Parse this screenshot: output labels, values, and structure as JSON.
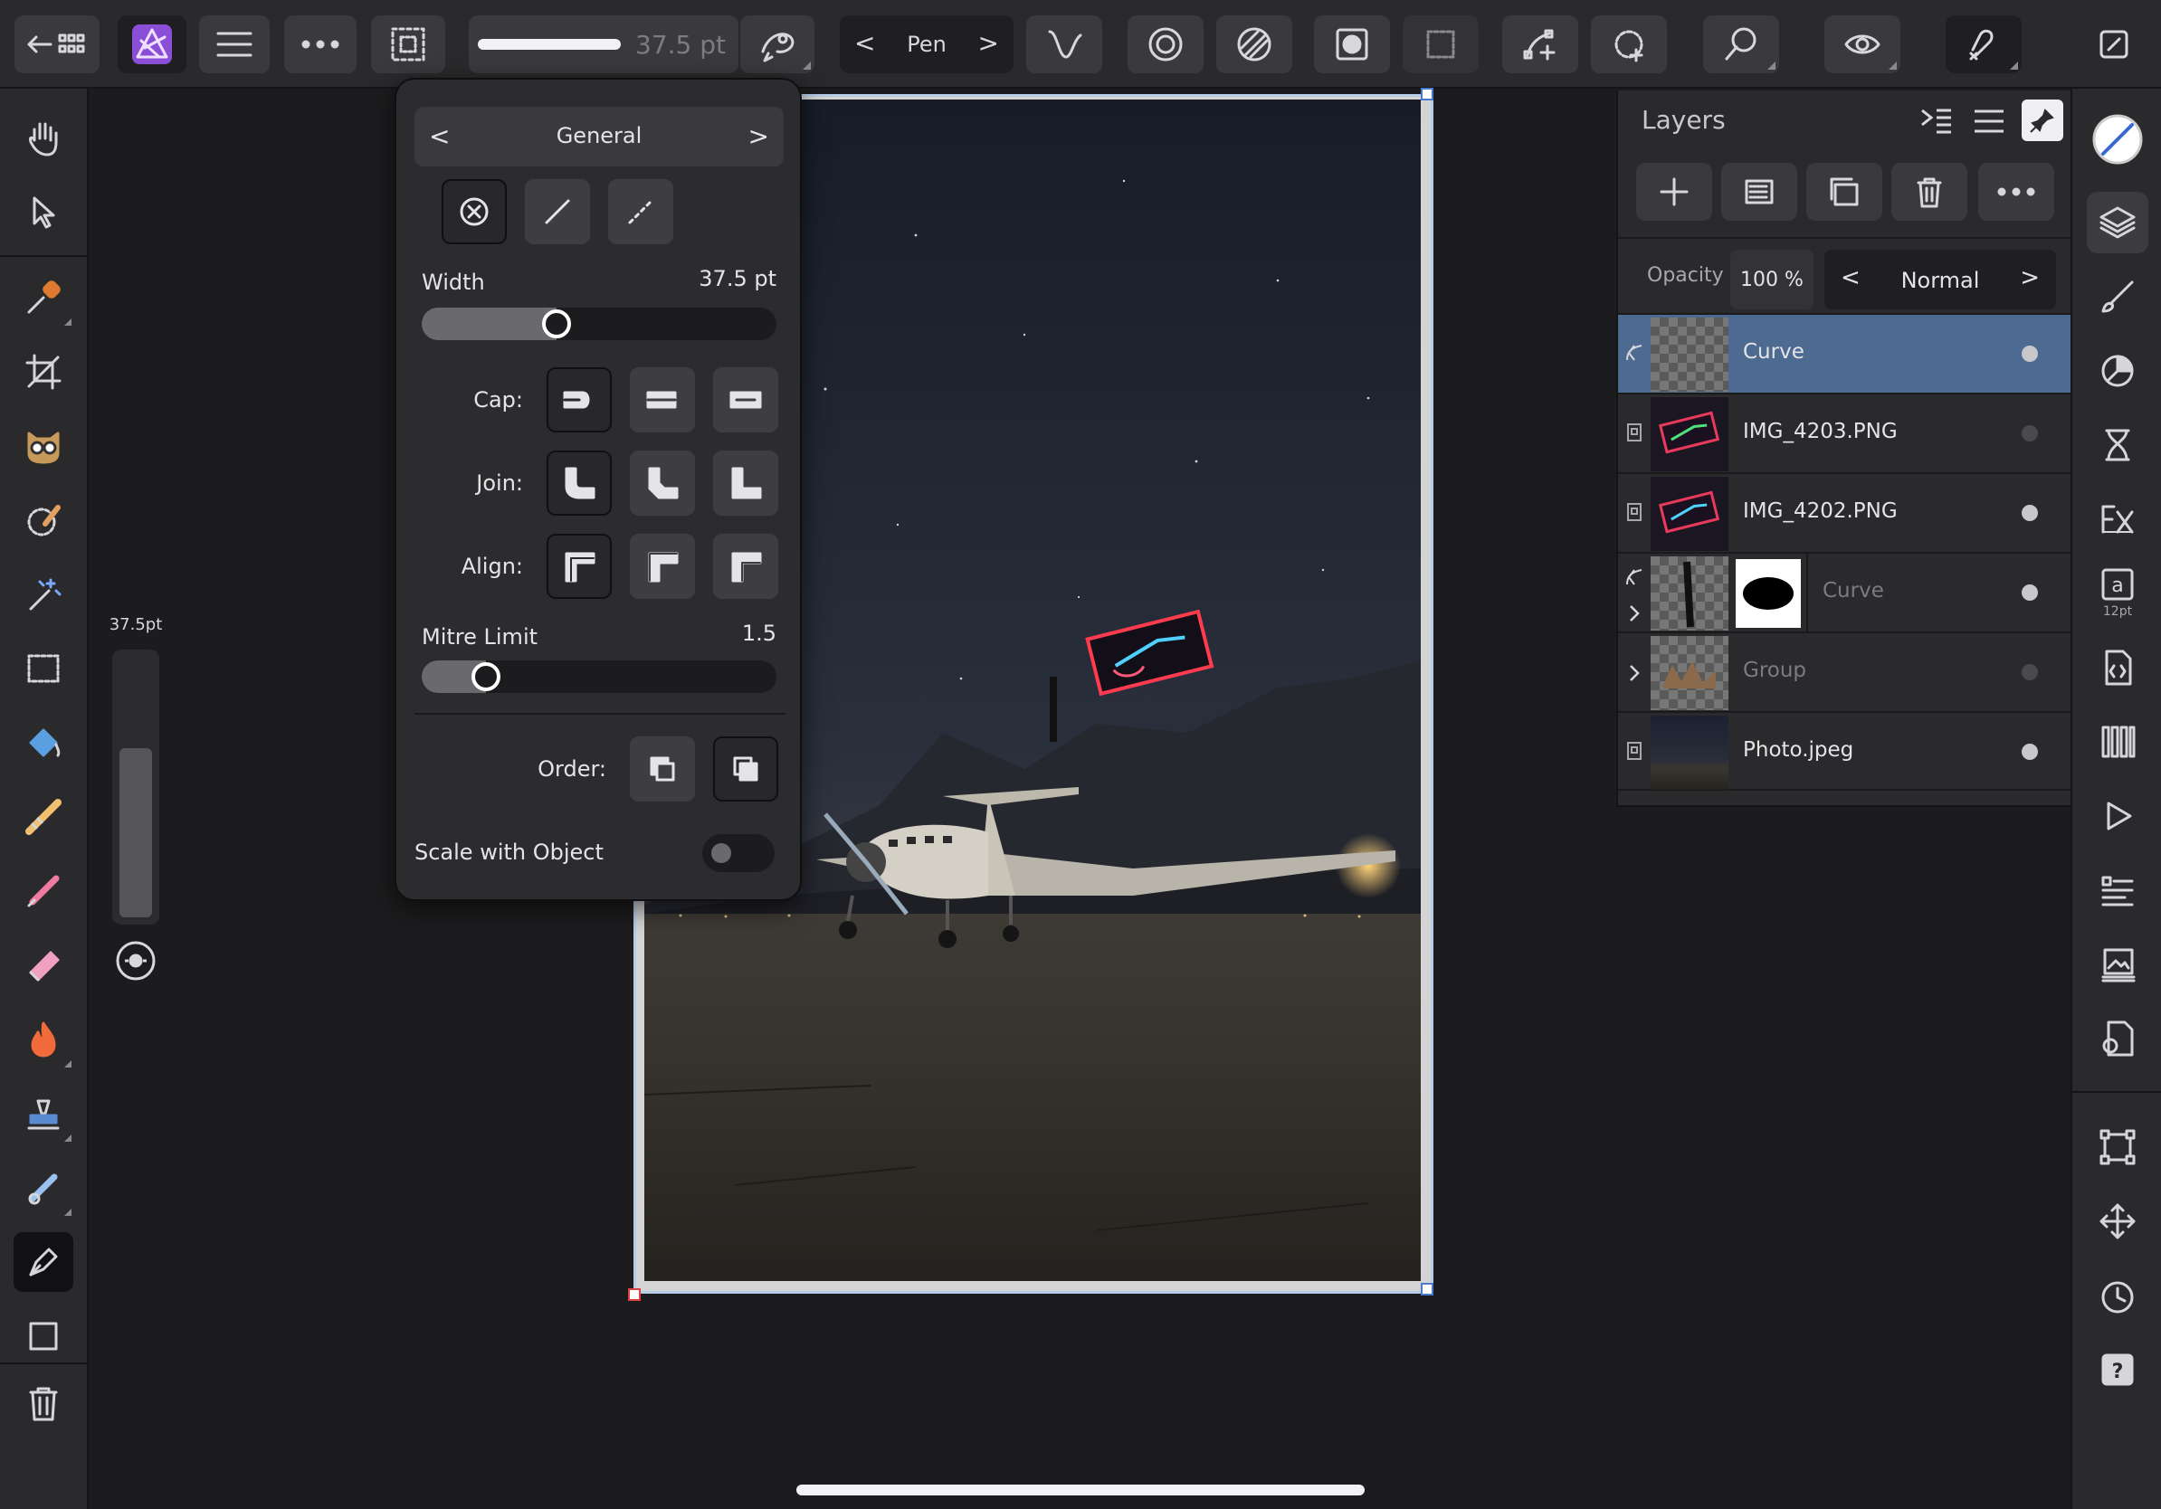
{
  "toolbar": {
    "stroke_width": "37.5 pt",
    "brush_name": "Pen"
  },
  "stroke_panel": {
    "category": "General",
    "width_label": "Width",
    "width_value": "37.5 pt",
    "width_fraction": 0.38,
    "cap_label": "Cap:",
    "join_label": "Join:",
    "align_label": "Align:",
    "mitre_label": "Mitre Limit",
    "mitre_value": "1.5",
    "mitre_fraction": 0.18,
    "order_label": "Order:",
    "scale_label": "Scale with Object",
    "scale_on": false
  },
  "side_slider": {
    "value": "37.5pt",
    "fraction": 0.65
  },
  "layers_panel": {
    "title": "Layers",
    "opacity_label": "Opacity",
    "opacity_value": "100 %",
    "blend_mode": "Normal",
    "rows": [
      {
        "name": "Curve",
        "selected": true,
        "visible": true
      },
      {
        "name": "IMG_4203.PNG",
        "selected": false,
        "visible": false
      },
      {
        "name": "IMG_4202.PNG",
        "selected": false,
        "visible": true
      },
      {
        "name": "Curve",
        "selected": false,
        "visible": true
      },
      {
        "name": "Group",
        "selected": false,
        "visible": false
      },
      {
        "name": "Photo.jpeg",
        "selected": false,
        "visible": true
      }
    ]
  },
  "right_tools": {
    "text_size": "12pt"
  },
  "colors": {
    "accent": "#4d6a91",
    "app_logo": "#8a4fd6",
    "background": "#1c1c1e"
  }
}
